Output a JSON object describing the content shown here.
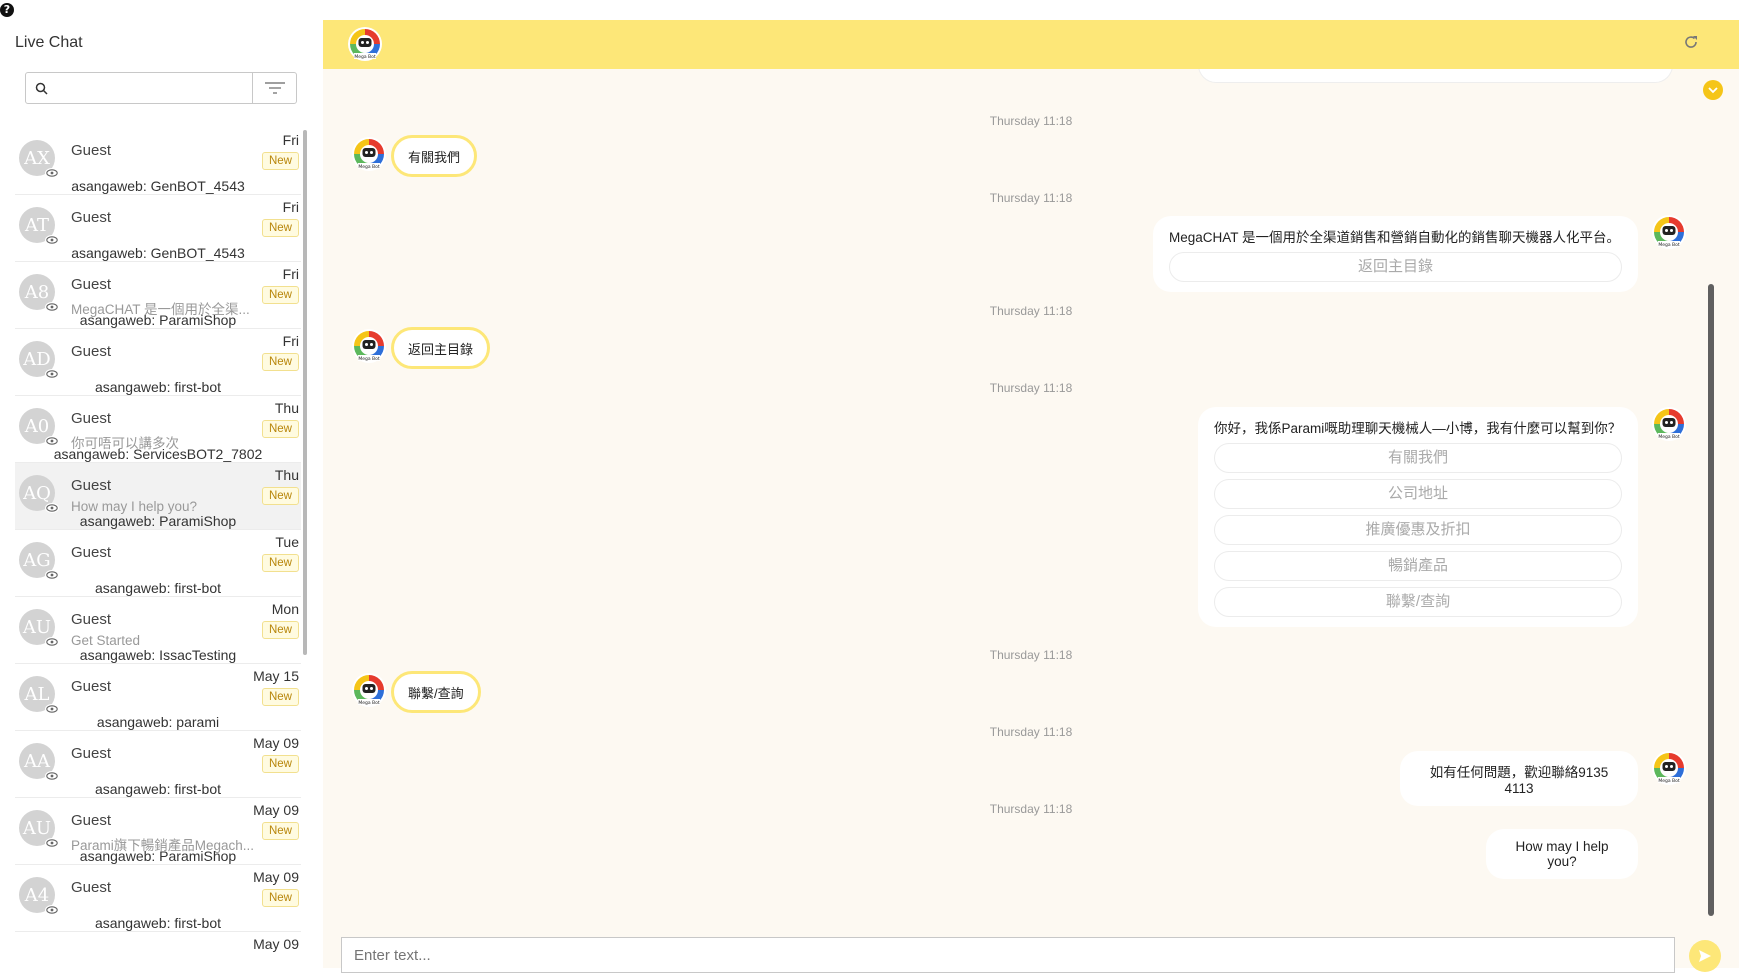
{
  "help_icon": "?",
  "sidebar": {
    "title": "Live Chat",
    "search": {
      "placeholder": "",
      "value": ""
    },
    "conversations": [
      {
        "initials": "AX",
        "name": "Guest",
        "preview": "",
        "source": "asangaweb: GenBOT_4543",
        "date": "Fri",
        "badge": "New"
      },
      {
        "initials": "AT",
        "name": "Guest",
        "preview": "",
        "source": "asangaweb: GenBOT_4543",
        "date": "Fri",
        "badge": "New"
      },
      {
        "initials": "A8",
        "name": "Guest",
        "preview": "MegaCHAT 是一個用於全渠...",
        "source": "asangaweb: ParamiShop",
        "date": "Fri",
        "badge": "New"
      },
      {
        "initials": "AD",
        "name": "Guest",
        "preview": "",
        "source": "asangaweb: first-bot",
        "date": "Fri",
        "badge": "New"
      },
      {
        "initials": "A0",
        "name": "Guest",
        "preview": "你可唔可以講多次",
        "source": "asangaweb: ServicesBOT2_7802",
        "date": "Thu",
        "badge": "New"
      },
      {
        "initials": "AQ",
        "name": "Guest",
        "preview": "How may I help you?",
        "source": "asangaweb: ParamiShop",
        "date": "Thu",
        "badge": "New"
      },
      {
        "initials": "AG",
        "name": "Guest",
        "preview": "",
        "source": "asangaweb: first-bot",
        "date": "Tue",
        "badge": "New"
      },
      {
        "initials": "AU",
        "name": "Guest",
        "preview": "Get Started",
        "source": "asangaweb: IssacTesting",
        "date": "Mon",
        "badge": "New"
      },
      {
        "initials": "AL",
        "name": "Guest",
        "preview": "",
        "source": "asangaweb: parami",
        "date": "May 15",
        "badge": "New"
      },
      {
        "initials": "AA",
        "name": "Guest",
        "preview": "",
        "source": "asangaweb: first-bot",
        "date": "May 09",
        "badge": "New"
      },
      {
        "initials": "AU",
        "name": "Guest",
        "preview": "Parami旗下暢銷產品Megach...",
        "source": "asangaweb: ParamiShop",
        "date": "May 09",
        "badge": "New"
      },
      {
        "initials": "A4",
        "name": "Guest",
        "preview": "",
        "source": "asangaweb: first-bot",
        "date": "May 09",
        "badge": "New"
      },
      {
        "initials": "",
        "name": "",
        "preview": "",
        "source": "",
        "date": "May 09",
        "badge": ""
      }
    ]
  },
  "chat": {
    "bot_logo_text": "Mega Bot",
    "timestamps": [
      "Thursday 11:18",
      "Thursday 11:18",
      "Thursday 11:18",
      "Thursday 11:18",
      "Thursday 11:18",
      "Thursday 11:18",
      "Thursday 11:18"
    ],
    "user_messages": [
      "有關我們",
      "返回主目錄",
      "聯繫/查詢"
    ],
    "bot_message_1": {
      "text": "MegaCHAT 是一個用於全渠道銷售和營銷自動化的銷售聊天機器人化平台。",
      "buttons": [
        "返回主目錄"
      ]
    },
    "bot_message_2": {
      "text": "你好，我係Parami嘅助理聊天機械人—小博，我有什麼可以幫到你？",
      "buttons": [
        "有關我們",
        "公司地址",
        "推廣優惠及折扣",
        "暢銷產品",
        "聯繫/查詢"
      ]
    },
    "bot_message_3": "如有任何問題，歡迎聯絡9135 4113",
    "bot_message_4": "How may I help you?",
    "input_placeholder": "Enter text..."
  },
  "colors": {
    "header_yellow": "#fde778",
    "chat_bg": "#fdf9f2",
    "badge_text": "#b8860b",
    "accent": "#f5c518"
  },
  "icons": [
    "search-icon",
    "filter-icon",
    "eye-icon",
    "refresh-icon",
    "chevron-down-icon",
    "send-icon",
    "bot-logo-icon"
  ]
}
